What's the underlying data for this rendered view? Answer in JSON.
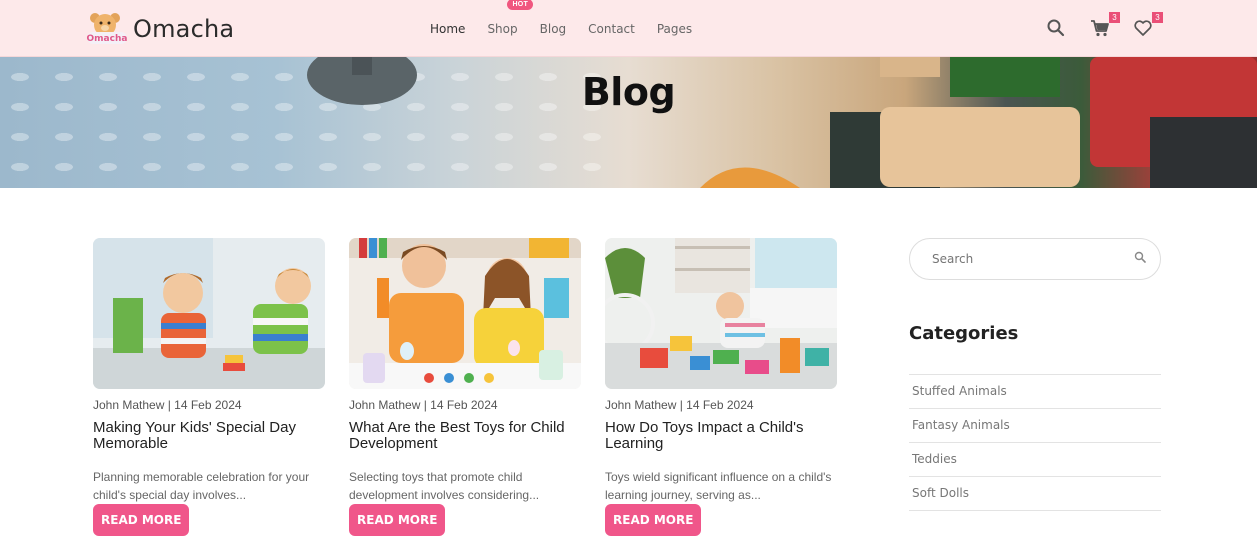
{
  "brand": {
    "name": "Omacha"
  },
  "nav": {
    "items": [
      {
        "label": "Home"
      },
      {
        "label": "Shop",
        "badge": "HOT"
      },
      {
        "label": "Blog"
      },
      {
        "label": "Contact"
      },
      {
        "label": "Pages"
      }
    ]
  },
  "header_icons": {
    "cart_count": "3",
    "wishlist_count": "3"
  },
  "banner": {
    "title": "Blog"
  },
  "posts": [
    {
      "meta": "John Mathew | 14 Feb 2024",
      "title": "Making Your Kids' Special Day Memorable",
      "excerpt": "Planning memorable celebration for your child's special day involves...",
      "button": "READ MORE"
    },
    {
      "meta": "John Mathew | 14 Feb 2024",
      "title": "What Are the Best Toys for Child Development",
      "excerpt": "Selecting toys that promote child development involves considering...",
      "button": "READ MORE"
    },
    {
      "meta": "John Mathew | 14 Feb 2024",
      "title": "How Do Toys Impact a Child's Learning",
      "excerpt": "Toys wield significant influence on a child's learning journey, serving as...",
      "button": "READ MORE"
    }
  ],
  "sidebar": {
    "search_placeholder": "Search",
    "categories_title": "Categories",
    "categories": [
      "Stuffed Animals",
      "Fantasy Animals",
      "Teddies",
      "Soft Dolls"
    ]
  },
  "colors": {
    "header_bg": "#fde9ea",
    "accent": "#f0568a",
    "badge": "#ea4f77"
  }
}
